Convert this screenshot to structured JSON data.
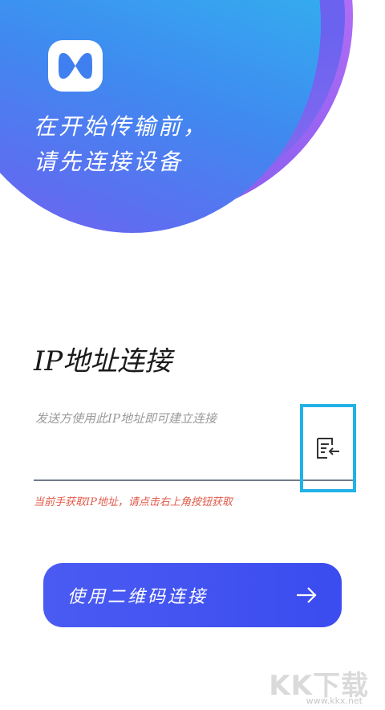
{
  "hero": {
    "line1": "在开始传输前，",
    "line2": "请先连接设备"
  },
  "ip_section": {
    "title": "IP地址连接",
    "input_placeholder": "发送方使用此IP地址即可建立连接",
    "input_value": "",
    "hint": "当前手获取IP地址，请点击右上角按钮获取"
  },
  "qr_button": {
    "label": "使用二维码连接"
  },
  "watermark": {
    "main": "KK下载",
    "sub": "www.kkx.net"
  },
  "colors": {
    "accent": "#3b4cf0",
    "highlight_border": "#22b1e6",
    "hint_red": "#e05a4a"
  },
  "icons": {
    "logo": "app-logo-icon",
    "paste": "paste-clipboard-icon",
    "arrow": "arrow-right-icon"
  }
}
